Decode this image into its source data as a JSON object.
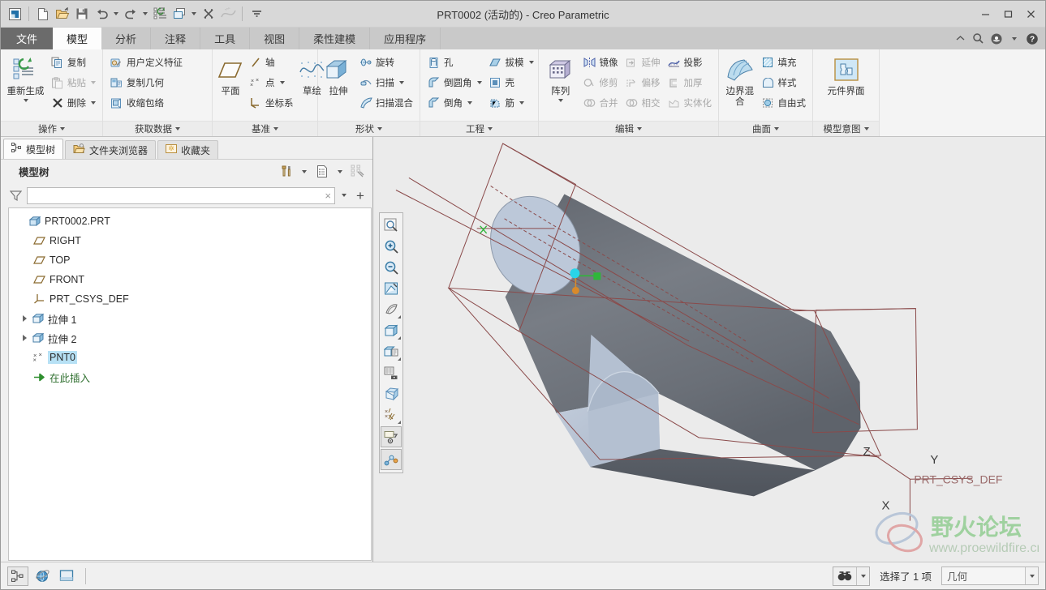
{
  "window": {
    "title": "PRT0002 (活动的) - Creo Parametric",
    "minimize": "−",
    "maximize": "□",
    "close": "×"
  },
  "quick_access": {
    "items": [
      {
        "name": "app-logo-icon",
        "label": ""
      },
      {
        "name": "new-icon",
        "label": ""
      },
      {
        "name": "open-icon",
        "label": ""
      },
      {
        "name": "save-icon",
        "label": ""
      },
      {
        "name": "undo-icon",
        "label": ""
      },
      {
        "name": "redo-icon",
        "label": ""
      },
      {
        "name": "regenerate-icon",
        "label": ""
      },
      {
        "name": "window-switch-icon",
        "label": ""
      },
      {
        "name": "close-window-icon",
        "label": ""
      },
      {
        "name": "spline-icon",
        "label": ""
      },
      {
        "name": "customize-qat-icon",
        "label": ""
      }
    ]
  },
  "ribbon": {
    "tabs": [
      {
        "label": "文件",
        "kind": "file"
      },
      {
        "label": "模型",
        "kind": "active"
      },
      {
        "label": "分析",
        "kind": "normal"
      },
      {
        "label": "注释",
        "kind": "normal"
      },
      {
        "label": "工具",
        "kind": "normal"
      },
      {
        "label": "视图",
        "kind": "normal"
      },
      {
        "label": "柔性建模",
        "kind": "normal"
      },
      {
        "label": "应用程序",
        "kind": "normal"
      }
    ],
    "right_icons": [
      {
        "name": "collapse-ribbon-icon",
        "glyph": "⌃"
      },
      {
        "name": "search-icon",
        "glyph": "⌕"
      },
      {
        "name": "account-icon",
        "glyph": "☻"
      },
      {
        "name": "account-dropdown-icon",
        "glyph": "▾"
      },
      {
        "name": "help-icon",
        "glyph": "?"
      }
    ],
    "groups": [
      {
        "label": "操作",
        "big": {
          "label": "重新生成",
          "icon": "regenerate-icon",
          "has_caret": true
        },
        "columns": [
          {
            "items": [
              {
                "label": "复制",
                "icon": "copy-icon",
                "disabled": false,
                "caret": false
              },
              {
                "label": "粘贴",
                "icon": "paste-icon",
                "disabled": true,
                "caret": true
              },
              {
                "label": "删除",
                "icon": "delete-icon",
                "disabled": false,
                "caret": true
              }
            ]
          }
        ]
      },
      {
        "label": "获取数据",
        "columns": [
          {
            "items": [
              {
                "label": "用户定义特征",
                "icon": "udf-icon",
                "disabled": false,
                "caret": false
              },
              {
                "label": "复制几何",
                "icon": "copy-geometry-icon",
                "disabled": false,
                "caret": false
              },
              {
                "label": "收缩包络",
                "icon": "shrinkwrap-icon",
                "disabled": false,
                "caret": false
              }
            ]
          }
        ]
      },
      {
        "label": "基准",
        "big": {
          "label": "平面",
          "icon": "datum-plane-icon",
          "has_caret": false
        },
        "columns": [
          {
            "items": [
              {
                "label": "轴",
                "icon": "datum-axis-icon",
                "disabled": false,
                "caret": false
              },
              {
                "label": "点",
                "icon": "datum-point-icon",
                "disabled": false,
                "caret": true
              },
              {
                "label": "坐标系",
                "icon": "coordinate-system-icon",
                "disabled": false,
                "caret": false
              }
            ]
          }
        ],
        "trailing_big": {
          "label": "草绘",
          "icon": "sketch-icon",
          "has_caret": false
        }
      },
      {
        "label": "形状",
        "big": {
          "label": "拉伸",
          "icon": "extrude-icon",
          "has_caret": false
        },
        "columns": [
          {
            "items": [
              {
                "label": "旋转",
                "icon": "revolve-icon",
                "disabled": false,
                "caret": false
              },
              {
                "label": "扫描",
                "icon": "sweep-icon",
                "disabled": false,
                "caret": true
              },
              {
                "label": "扫描混合",
                "icon": "swept-blend-icon",
                "disabled": false,
                "caret": false
              }
            ]
          }
        ]
      },
      {
        "label": "工程",
        "columns": [
          {
            "items": [
              {
                "label": "孔",
                "icon": "hole-icon",
                "disabled": false,
                "caret": false
              },
              {
                "label": "倒圆角",
                "icon": "round-icon",
                "disabled": false,
                "caret": true
              },
              {
                "label": "倒角",
                "icon": "chamfer-icon",
                "disabled": false,
                "caret": true
              }
            ]
          },
          {
            "items": [
              {
                "label": "拔模",
                "icon": "draft-icon",
                "disabled": false,
                "caret": true
              },
              {
                "label": "壳",
                "icon": "shell-icon",
                "disabled": false,
                "caret": false
              },
              {
                "label": "筋",
                "icon": "rib-icon",
                "disabled": false,
                "caret": true
              }
            ]
          }
        ]
      },
      {
        "label": "编辑",
        "big": {
          "label": "阵列",
          "icon": "pattern-icon",
          "has_caret": true
        },
        "columns": [
          {
            "items": [
              {
                "label": "镜像",
                "icon": "mirror-icon",
                "disabled": false,
                "caret": false
              },
              {
                "label": "修剪",
                "icon": "trim-icon",
                "disabled": true,
                "caret": false
              },
              {
                "label": "合并",
                "icon": "merge-icon",
                "disabled": true,
                "caret": false
              }
            ]
          },
          {
            "items": [
              {
                "label": "延伸",
                "icon": "extend-icon",
                "disabled": true,
                "caret": false
              },
              {
                "label": "偏移",
                "icon": "offset-icon",
                "disabled": true,
                "caret": false
              },
              {
                "label": "相交",
                "icon": "intersect-icon",
                "disabled": true,
                "caret": false
              }
            ]
          },
          {
            "items": [
              {
                "label": "投影",
                "icon": "project-icon",
                "disabled": false,
                "caret": false
              },
              {
                "label": "加厚",
                "icon": "thicken-icon",
                "disabled": true,
                "caret": false
              },
              {
                "label": "实体化",
                "icon": "solidify-icon",
                "disabled": true,
                "caret": false
              }
            ]
          }
        ]
      },
      {
        "label": "曲面",
        "big": {
          "label": "边界混合",
          "icon": "boundary-blend-icon",
          "has_caret": false
        },
        "columns": [
          {
            "items": [
              {
                "label": "填充",
                "icon": "fill-icon",
                "disabled": false,
                "caret": false
              },
              {
                "label": "样式",
                "icon": "style-icon",
                "disabled": false,
                "caret": false
              },
              {
                "label": "自由式",
                "icon": "freestyle-icon",
                "disabled": false,
                "caret": false
              }
            ]
          }
        ]
      },
      {
        "label": "模型意图",
        "big": {
          "label": "元件界面",
          "icon": "component-interface-icon",
          "has_caret": false
        },
        "columns": []
      }
    ]
  },
  "left_panel": {
    "tabs": [
      {
        "label": "模型树",
        "icon": "model-tree-icon",
        "active": true
      },
      {
        "label": "文件夹浏览器",
        "icon": "folder-browser-icon",
        "active": false
      },
      {
        "label": "收藏夹",
        "icon": "favorites-icon",
        "active": false
      }
    ],
    "header_title": "模型树",
    "header_tools": [
      {
        "name": "settings-tools-icon"
      },
      {
        "name": "settings-dropdown-icon"
      },
      {
        "name": "display-list-icon"
      },
      {
        "name": "display-dropdown-icon"
      },
      {
        "name": "tree-filters-icon"
      }
    ],
    "filter": {
      "placeholder": "",
      "value": "",
      "clear_glyph": "×",
      "dropdown_glyph": "▾",
      "add_glyph": "+"
    },
    "tree": [
      {
        "label": "PRT0002.PRT",
        "icon": "part-icon",
        "indent": 0,
        "expander": false,
        "selected": false
      },
      {
        "label": "RIGHT",
        "icon": "datum-plane-icon",
        "indent": 1,
        "expander": false,
        "selected": false
      },
      {
        "label": "TOP",
        "icon": "datum-plane-icon",
        "indent": 1,
        "expander": false,
        "selected": false
      },
      {
        "label": "FRONT",
        "icon": "datum-plane-icon",
        "indent": 1,
        "expander": false,
        "selected": false
      },
      {
        "label": "PRT_CSYS_DEF",
        "icon": "coordinate-system-icon",
        "indent": 1,
        "expander": false,
        "selected": false
      },
      {
        "label": "拉伸 1",
        "icon": "extrude-feature-icon",
        "indent": 1,
        "expander": true,
        "selected": false
      },
      {
        "label": "拉伸 2",
        "icon": "extrude-feature-icon",
        "indent": 1,
        "expander": true,
        "selected": false
      },
      {
        "label": "PNT0",
        "icon": "datum-point-icon",
        "indent": 1,
        "expander": false,
        "selected": true
      },
      {
        "label": "在此插入",
        "icon": "insert-here-icon",
        "indent": 1,
        "expander": false,
        "selected": false
      }
    ]
  },
  "graphics": {
    "vertical_toolbar": [
      {
        "name": "zoom-fit-icon",
        "caret": false,
        "framed": false
      },
      {
        "name": "zoom-in-icon",
        "caret": false,
        "framed": false
      },
      {
        "name": "zoom-out-icon",
        "caret": false,
        "framed": false
      },
      {
        "name": "refit-icon",
        "caret": false,
        "framed": false
      },
      {
        "name": "reorient-icon",
        "caret": true,
        "framed": false
      },
      {
        "name": "display-style-icon",
        "caret": true,
        "framed": false
      },
      {
        "name": "saved-views-icon",
        "caret": true,
        "framed": false
      },
      {
        "name": "view-manager-icon",
        "caret": false,
        "framed": false
      },
      {
        "name": "perspective-view-icon",
        "caret": false,
        "framed": false
      },
      {
        "name": "datum-display-icon",
        "caret": true,
        "framed": false
      },
      {
        "name": "annotation-display-icon",
        "caret": false,
        "framed": true
      },
      {
        "name": "spin-center-icon",
        "caret": false,
        "framed": true
      }
    ],
    "csys_labels": {
      "x": "X",
      "y": "Y",
      "z": "Z",
      "name": "PRT_CSYS_DEF"
    },
    "colors": {
      "background": "#ebebeb",
      "solid_dark": "#6e7278",
      "solid_light": "#b9c5d6",
      "edge_red": "#8a4a4a",
      "point_cyan": "#2ad4e8",
      "point_green": "#2fb63a",
      "point_orange": "#d98a2b"
    }
  },
  "watermark": {
    "title": "野火论坛",
    "url": "www.proewildfire.cn"
  },
  "statusbar": {
    "left_buttons": [
      {
        "name": "model-tree-toggle-icon",
        "framed": true
      },
      {
        "name": "globe-browser-icon",
        "framed": false
      },
      {
        "name": "graphics-window-icon",
        "framed": false
      }
    ],
    "find_icon": "find-icon",
    "find_caret": "▾",
    "selection_text": "选择了 1 项",
    "filter_value": "几何",
    "filter_caret": "▾"
  }
}
